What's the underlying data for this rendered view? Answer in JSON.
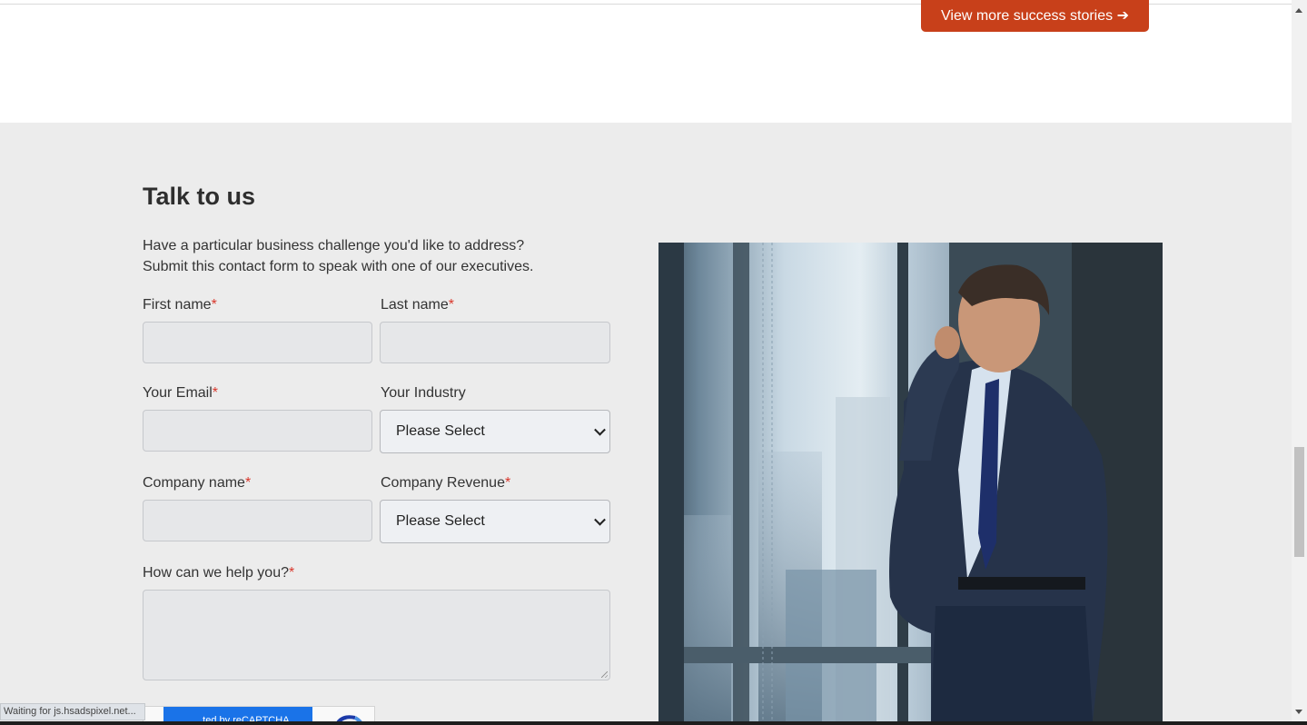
{
  "top": {
    "cta_label": "View more success stories ➔"
  },
  "contact": {
    "title": "Talk to us",
    "intro_line1": "Have a particular business challenge you'd like to address?",
    "intro_line2": "Submit this contact form to speak with one of our executives.",
    "required_mark": "*",
    "first_name_label": "First name",
    "last_name_label": "Last name",
    "email_label": "Your Email",
    "industry_label": "Your Industry",
    "company_name_label": "Company name",
    "company_revenue_label": "Company Revenue",
    "help_label": "How can we help you?",
    "industry_select_value": "Please Select",
    "revenue_select_value": "Please Select"
  },
  "browser": {
    "status_text": "Waiting for js.hsadspixel.net...",
    "recaptcha_text": "...ted by reCAPTCHA"
  },
  "colors": {
    "accent": "#c8401a",
    "required": "#d9372b",
    "section_bg": "#ececec"
  }
}
